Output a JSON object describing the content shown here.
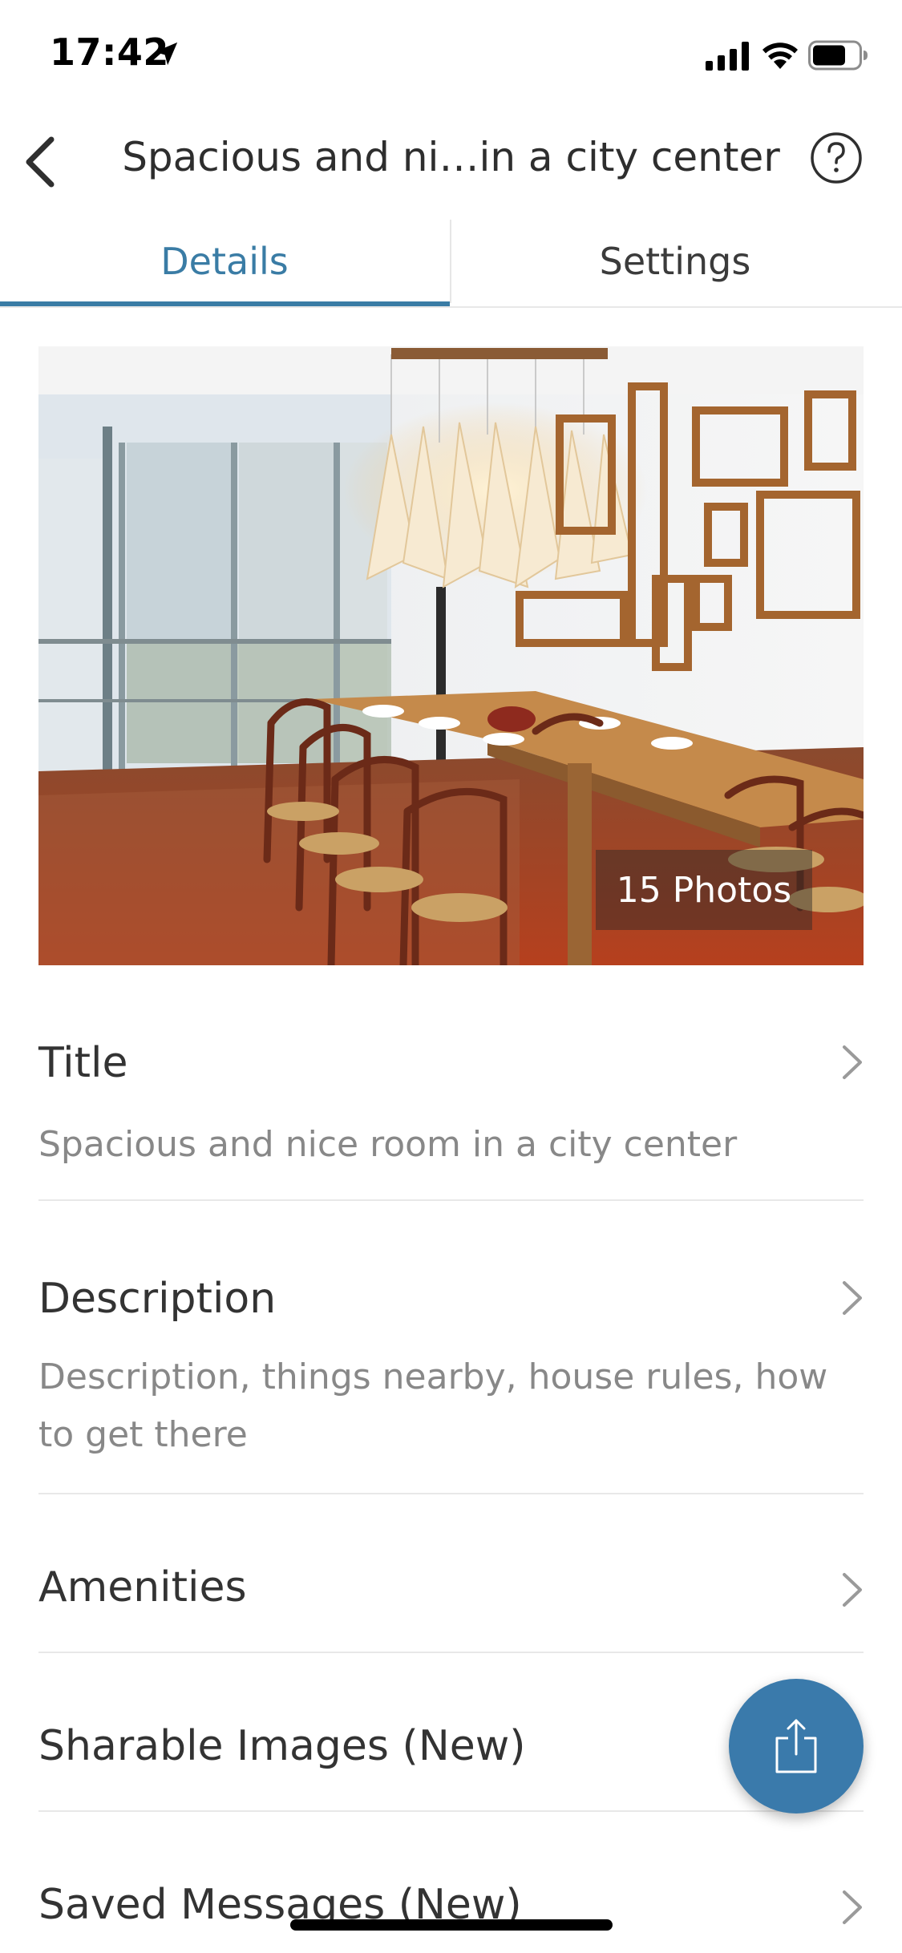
{
  "status_bar": {
    "time": "17:42",
    "icons": [
      "location-arrow-icon",
      "cellular-signal-icon",
      "wifi-icon",
      "battery-icon"
    ]
  },
  "nav": {
    "back_icon": "chevron-left-icon",
    "title": "Spacious and ni…in a city center",
    "help_icon": "question-circle-icon"
  },
  "tabs": [
    {
      "label": "Details",
      "active": true
    },
    {
      "label": "Settings",
      "active": false
    }
  ],
  "photo": {
    "badge": "15 Photos"
  },
  "rows": [
    {
      "title": "Title",
      "subtitle": "Spacious and nice room in a city center"
    },
    {
      "title": "Description",
      "subtitle": "Description, things nearby, house rules, how to get there"
    },
    {
      "title": "Amenities",
      "subtitle": ""
    },
    {
      "title": "Sharable Images (New)",
      "subtitle": ""
    },
    {
      "title": "Saved Messages (New)",
      "subtitle": ""
    }
  ],
  "fab": {
    "icon": "share-icon"
  },
  "colors": {
    "accent": "#3a7ca5",
    "fab": "#3a7aab",
    "text_primary": "#333333",
    "text_secondary": "#888888",
    "divider": "#e8e8e8"
  }
}
